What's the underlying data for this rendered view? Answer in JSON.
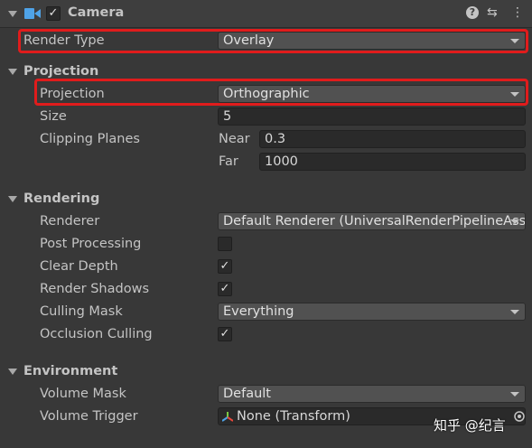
{
  "header": {
    "title": "Camera",
    "enabled_check": "✓",
    "help_glyph": "?",
    "presets_glyph": "⇆",
    "menu_glyph": "⋮"
  },
  "render_type": {
    "label": "Render Type",
    "value": "Overlay"
  },
  "projection_section": {
    "title": "Projection",
    "projection": {
      "label": "Projection",
      "value": "Orthographic"
    },
    "size": {
      "label": "Size",
      "value": "5"
    },
    "clipping": {
      "label": "Clipping Planes",
      "near_label": "Near",
      "near_value": "0.3",
      "far_label": "Far",
      "far_value": "1000"
    }
  },
  "rendering_section": {
    "title": "Rendering",
    "renderer": {
      "label": "Renderer",
      "value": "Default Renderer (UniversalRenderPipelineAsset)"
    },
    "post_processing": {
      "label": "Post Processing",
      "check": ""
    },
    "clear_depth": {
      "label": "Clear Depth",
      "check": "✓"
    },
    "render_shadows": {
      "label": "Render Shadows",
      "check": "✓"
    },
    "culling_mask": {
      "label": "Culling Mask",
      "value": "Everything"
    },
    "occlusion_culling": {
      "label": "Occlusion Culling",
      "check": "✓"
    }
  },
  "environment_section": {
    "title": "Environment",
    "volume_mask": {
      "label": "Volume Mask",
      "value": "Default"
    },
    "volume_trigger": {
      "label": "Volume Trigger",
      "value": "None (Transform)"
    }
  },
  "watermark": "知乎 @纪言",
  "colors": {
    "highlight": "#e01c1c",
    "camera_icon": "#4fa3e8"
  }
}
